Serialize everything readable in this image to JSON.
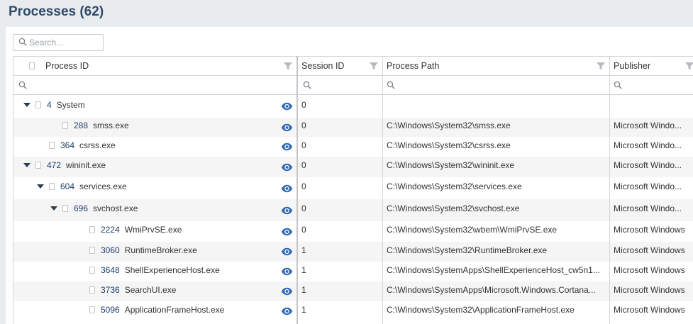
{
  "page": {
    "title": "Processes (62)"
  },
  "search": {
    "placeholder": "Search..."
  },
  "columns": [
    {
      "label": "Process ID"
    },
    {
      "label": "Session ID"
    },
    {
      "label": "Process Path"
    },
    {
      "label": "Publisher"
    }
  ],
  "icons": {
    "search": "search-icon",
    "filter": "filter-icon",
    "eye": "eye-icon",
    "bookmark": "bookmark-icon",
    "expand": "caret-down-icon"
  },
  "colors": {
    "title": "#2f4a6a",
    "pid": "#1d3e66",
    "eye": "#2f69b8"
  },
  "rows": [
    {
      "pid": "4",
      "name": "System",
      "session": "0",
      "path": "",
      "publisher": ""
    },
    {
      "pid": "288",
      "name": "smss.exe",
      "session": "0",
      "path": "C:\\Windows\\System32\\smss.exe",
      "publisher": "Microsoft Windo..."
    },
    {
      "pid": "364",
      "name": "csrss.exe",
      "session": "0",
      "path": "C:\\Windows\\System32\\csrss.exe",
      "publisher": "Microsoft Windo..."
    },
    {
      "pid": "472",
      "name": "wininit.exe",
      "session": "0",
      "path": "C:\\Windows\\System32\\wininit.exe",
      "publisher": "Microsoft Windo..."
    },
    {
      "pid": "604",
      "name": "services.exe",
      "session": "0",
      "path": "C:\\Windows\\System32\\services.exe",
      "publisher": "Microsoft Windo..."
    },
    {
      "pid": "696",
      "name": "svchost.exe",
      "session": "0",
      "path": "C:\\Windows\\System32\\svchost.exe",
      "publisher": "Microsoft Windo..."
    },
    {
      "pid": "2224",
      "name": "WmiPrvSE.exe",
      "session": "0",
      "path": "C:\\Windows\\System32\\wbem\\WmiPrvSE.exe",
      "publisher": "Microsoft Windows"
    },
    {
      "pid": "3060",
      "name": "RuntimeBroker.exe",
      "session": "1",
      "path": "C:\\Windows\\System32\\RuntimeBroker.exe",
      "publisher": "Microsoft Windows"
    },
    {
      "pid": "3648",
      "name": "ShellExperienceHost.exe",
      "session": "1",
      "path": "C:\\Windows\\SystemApps\\ShellExperienceHost_cw5n1...",
      "publisher": "Microsoft Windows"
    },
    {
      "pid": "3736",
      "name": "SearchUI.exe",
      "session": "1",
      "path": "C:\\Windows\\SystemApps\\Microsoft.Windows.Cortana...",
      "publisher": "Microsoft Windows"
    },
    {
      "pid": "5096",
      "name": "ApplicationFrameHost.exe",
      "session": "1",
      "path": "C:\\Windows\\System32\\ApplicationFrameHost.exe",
      "publisher": "Microsoft Windows"
    }
  ]
}
